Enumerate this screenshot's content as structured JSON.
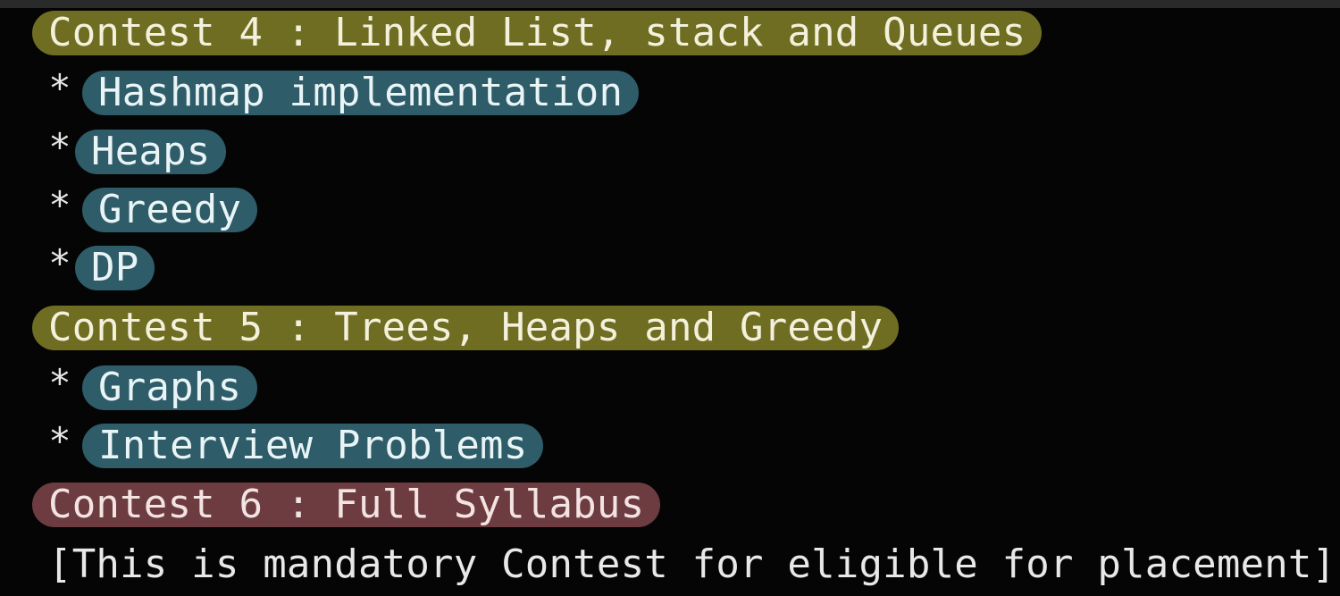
{
  "lines": {
    "contest4": "Contest 4 : Linked List, stack and Queues",
    "bullet_symbol": "*",
    "item_hashmap": "Hashmap implementation",
    "item_heaps": "Heaps",
    "item_greedy": "Greedy",
    "item_dp": "DP",
    "contest5": "Contest 5 : Trees, Heaps and Greedy",
    "item_graphs": "Graphs",
    "item_interview": "Interview Problems",
    "contest6": "Contest 6 : Full Syllabus",
    "note": "[This is mandatory Contest for eligible for placement]"
  },
  "colors": {
    "background": "#050505",
    "contest_highlight": "#6f6d22",
    "item_highlight": "#2e5c68",
    "final_contest_highlight": "#6d3c40"
  }
}
